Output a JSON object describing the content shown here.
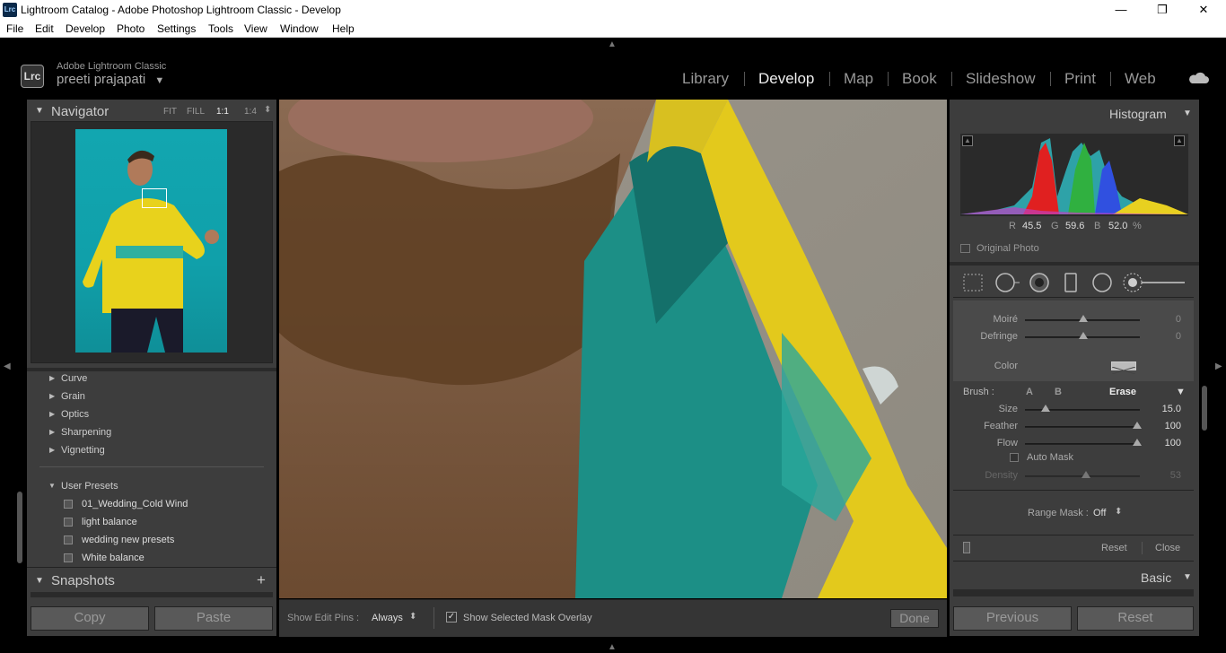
{
  "window": {
    "app_icon": "Lrc",
    "title": "Lightroom Catalog - Adobe Photoshop Lightroom Classic - Develop",
    "minimize": "—",
    "restore": "❐",
    "close": "✕"
  },
  "menu": [
    "File",
    "Edit",
    "Develop",
    "Photo",
    "Settings",
    "Tools",
    "View",
    "Window",
    "Help"
  ],
  "identity": {
    "logo": "Lrc",
    "product": "Adobe Lightroom Classic",
    "user": "preeti prajapati",
    "user_caret": "▼"
  },
  "modules": [
    "Library",
    "Develop",
    "Map",
    "Book",
    "Slideshow",
    "Print",
    "Web"
  ],
  "active_module": "Develop",
  "navigator": {
    "title": "Navigator",
    "zoom_options": [
      "FIT",
      "FILL",
      "1:1",
      "1:4"
    ],
    "active_zoom": "1:1",
    "zoom_caret": "⬍"
  },
  "presets": {
    "groups": [
      "Curve",
      "Grain",
      "Optics",
      "Sharpening",
      "Vignetting"
    ],
    "user_group": "User Presets",
    "user_items": [
      "01_Wedding_Cold Wind",
      "light balance",
      "wedding new presets",
      "White balance"
    ]
  },
  "snapshots": {
    "title": "Snapshots",
    "add": "+"
  },
  "left_buttons": {
    "copy": "Copy",
    "paste": "Paste"
  },
  "toolbar": {
    "edit_pins_label": "Show Edit Pins :",
    "edit_pins_value": "Always",
    "edit_pins_caret": "⬍",
    "mask_overlay_label": "Show Selected Mask Overlay",
    "mask_overlay_checked": true,
    "done": "Done"
  },
  "histogram": {
    "title": "Histogram",
    "r_label": "R",
    "r_value": "45.5",
    "g_label": "G",
    "g_value": "59.6",
    "b_label": "B",
    "b_value": "52.0",
    "unit": "%",
    "original_photo": "Original Photo"
  },
  "tools": [
    "crop-overlay",
    "spot-removal",
    "red-eye",
    "graduated-filter",
    "radial-filter",
    "adjustment-brush"
  ],
  "adjust": {
    "sliders": [
      {
        "label": "Moiré",
        "value": "0"
      },
      {
        "label": "Defringe",
        "value": "0"
      }
    ],
    "color_label": "Color"
  },
  "brush": {
    "label": "Brush :",
    "options": [
      "A",
      "B",
      "Erase"
    ],
    "active": "Erase",
    "caret": "▼",
    "sliders": [
      {
        "label": "Size",
        "value": "15.0"
      },
      {
        "label": "Feather",
        "value": "100"
      },
      {
        "label": "Flow",
        "value": "100"
      }
    ],
    "auto_mask": "Auto Mask",
    "density_label": "Density",
    "density_value": "53"
  },
  "range_mask": {
    "label": "Range Mask :",
    "value": "Off",
    "caret": "⬍"
  },
  "mask_footer": {
    "reset": "Reset",
    "close": "Close"
  },
  "basic": {
    "title": "Basic",
    "caret": "▼"
  },
  "right_buttons": {
    "previous": "Previous",
    "reset": "Reset"
  },
  "colors": {
    "accent_bg": "#3d3d3d",
    "photo_teal": "#1fa59c",
    "photo_yellow": "#e3c91c"
  }
}
